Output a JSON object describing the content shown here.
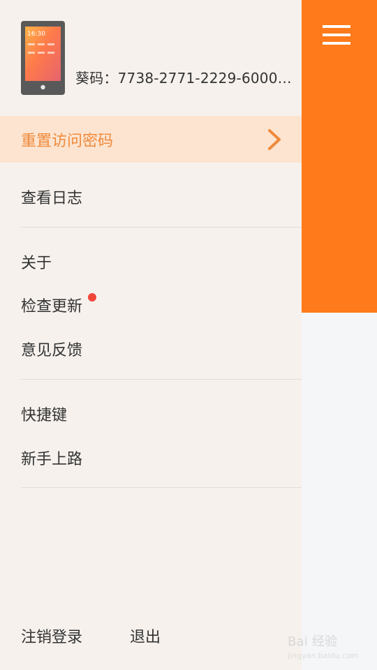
{
  "colors": {
    "accent_orange": "#ff7a1a",
    "drawer_background": "#f6f1ed",
    "highlight_background": "#fde4d0",
    "highlight_text": "#ef8a3c",
    "badge_red": "#f1453a"
  },
  "header": {
    "device_icon": "phone-icon",
    "device_code": "葵码：7738-2771-2229-6000-…"
  },
  "menu": {
    "highlight": {
      "label": "重置访问密码",
      "icon": "chevron-right-icon"
    },
    "items": [
      {
        "label": "查看日志"
      },
      {
        "label": "关于"
      },
      {
        "label": "检查更新",
        "badge": "red-dot"
      },
      {
        "label": "意见反馈"
      },
      {
        "label": "快捷键"
      },
      {
        "label": "新手上路"
      }
    ]
  },
  "footer": {
    "logout": "注销登录",
    "exit": "退出"
  },
  "right_panel": {
    "menu_icon": "hamburger-menu-icon"
  },
  "watermark": {
    "text": "Bai 经验",
    "subtext": "jingyan.baidu.com"
  }
}
